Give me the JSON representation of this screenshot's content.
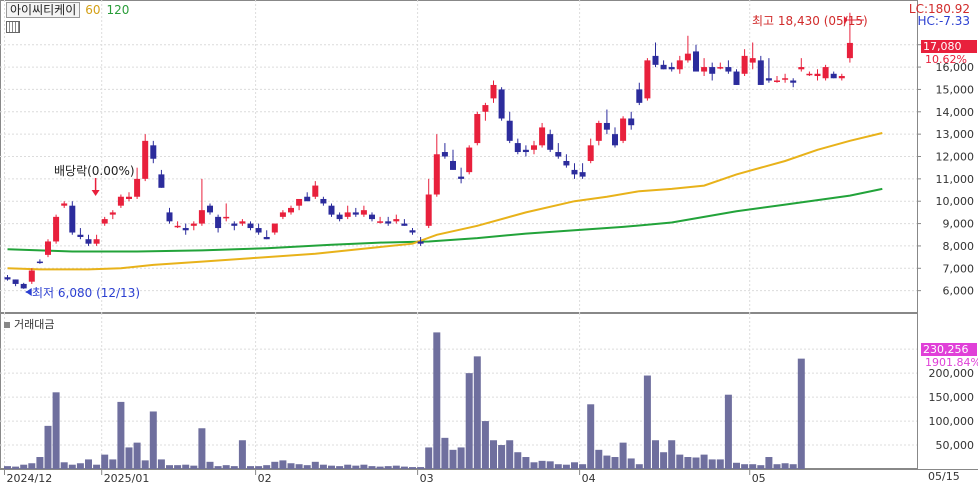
{
  "header": {
    "stock_name": "아이씨티케이",
    "ma_labels": [
      "60",
      "120"
    ],
    "lc": "LC:180.92",
    "hc": "HC:-7.33",
    "volume_title": "거래대금"
  },
  "current": {
    "price_label": "17,080",
    "pct_label": "10.62%",
    "volume_label": "230,256",
    "volume_pct_label": "1901.84%"
  },
  "annotations": {
    "high": "최고 18,430 (05/15)",
    "low": "최저 6,080 (12/13)",
    "dividend": "배당락(0.00%)"
  },
  "latest_date": "05/15",
  "colors": {
    "up": "#e8203c",
    "down": "#2c2c9c",
    "ma60": "#e8b21a",
    "ma120": "#22a33a",
    "volume": "#6f6f9e"
  },
  "chart_data": {
    "type": "candlestick",
    "price_axis": {
      "min": 5000,
      "max": 19000,
      "ticks": [
        "6,000",
        "7,000",
        "8,000",
        "9,000",
        "10,000",
        "11,000",
        "12,000",
        "13,000",
        "14,000",
        "15,000",
        "16,000",
        "17,000"
      ]
    },
    "volume_axis": {
      "min": 0,
      "max": 290000,
      "ticks": [
        "50,000",
        "100,000",
        "150,000",
        "200,000",
        "250,000"
      ]
    },
    "x_labels": [
      {
        "label": "2024/12",
        "index": 0
      },
      {
        "label": "2025/01",
        "index": 12
      },
      {
        "label": "02",
        "index": 31
      },
      {
        "label": "03",
        "index": 51
      },
      {
        "label": "04",
        "index": 71
      },
      {
        "label": "05",
        "index": 92
      }
    ],
    "candles": [
      [
        6600,
        6700,
        6450,
        6500
      ],
      [
        6500,
        6500,
        6200,
        6300
      ],
      [
        6300,
        6350,
        6080,
        6100
      ],
      [
        6400,
        7000,
        6300,
        6900
      ],
      [
        7300,
        7400,
        7200,
        7250
      ],
      [
        7600,
        8300,
        7500,
        8200
      ],
      [
        8200,
        9400,
        8100,
        9300
      ],
      [
        9800,
        10000,
        9700,
        9900
      ],
      [
        9800,
        10000,
        8500,
        8600
      ],
      [
        8500,
        8800,
        8300,
        8400
      ],
      [
        8300,
        8500,
        8000,
        8100
      ],
      [
        8100,
        8500,
        8000,
        8300
      ],
      [
        9000,
        9300,
        8900,
        9200
      ],
      [
        9400,
        9600,
        9200,
        9500
      ],
      [
        9800,
        10300,
        9700,
        10200
      ],
      [
        10100,
        10400,
        10000,
        10200
      ],
      [
        10200,
        11500,
        10100,
        11000
      ],
      [
        11000,
        13000,
        10900,
        12700
      ],
      [
        12500,
        12700,
        11700,
        11900
      ],
      [
        11200,
        11400,
        10600,
        10600
      ],
      [
        9500,
        9700,
        9000,
        9100
      ],
      [
        8900,
        9100,
        8800,
        8900
      ],
      [
        8800,
        9000,
        8500,
        8700
      ],
      [
        8900,
        9100,
        8700,
        9000
      ],
      [
        9000,
        11000,
        8900,
        9600
      ],
      [
        9800,
        9900,
        9400,
        9500
      ],
      [
        9300,
        9400,
        8600,
        8800
      ],
      [
        9300,
        9900,
        9100,
        9300
      ],
      [
        9000,
        9100,
        8700,
        8900
      ],
      [
        9000,
        9200,
        8900,
        9100
      ],
      [
        9000,
        9100,
        8700,
        8800
      ],
      [
        8800,
        9000,
        8500,
        8600
      ],
      [
        8400,
        8700,
        8300,
        8300
      ],
      [
        8600,
        9000,
        8500,
        9000
      ],
      [
        9300,
        9600,
        9200,
        9500
      ],
      [
        9500,
        9800,
        9400,
        9700
      ],
      [
        9800,
        10000,
        9600,
        10100
      ],
      [
        10200,
        10400,
        10000,
        10000
      ],
      [
        10200,
        10900,
        10100,
        10700
      ],
      [
        10100,
        10200,
        9800,
        9900
      ],
      [
        9800,
        9900,
        9300,
        9400
      ],
      [
        9400,
        9500,
        9100,
        9200
      ],
      [
        9300,
        9800,
        9200,
        9500
      ],
      [
        9500,
        9700,
        9300,
        9400
      ],
      [
        9400,
        9800,
        9300,
        9600
      ],
      [
        9400,
        9500,
        9100,
        9200
      ],
      [
        9100,
        9300,
        9000,
        9100
      ],
      [
        9100,
        9300,
        8900,
        9000
      ],
      [
        9100,
        9400,
        9000,
        9200
      ],
      [
        9000,
        9200,
        8900,
        8900
      ],
      [
        8700,
        8800,
        8500,
        8600
      ],
      [
        8200,
        8400,
        8000,
        8100
      ],
      [
        8900,
        11000,
        8800,
        10300
      ],
      [
        10300,
        13000,
        10200,
        12100
      ],
      [
        12200,
        12600,
        11900,
        12000
      ],
      [
        11800,
        12300,
        11400,
        11400
      ],
      [
        11100,
        11500,
        10800,
        11000
      ],
      [
        11300,
        12500,
        11200,
        12400
      ],
      [
        12600,
        14000,
        12500,
        13900
      ],
      [
        14000,
        14400,
        13600,
        14300
      ],
      [
        14600,
        15400,
        14400,
        15200
      ],
      [
        15000,
        15100,
        13600,
        13700
      ],
      [
        13600,
        14000,
        12600,
        12700
      ],
      [
        12600,
        12800,
        12100,
        12200
      ],
      [
        12300,
        12500,
        12000,
        12200
      ],
      [
        12300,
        12700,
        12100,
        12500
      ],
      [
        12500,
        13500,
        12400,
        13300
      ],
      [
        13000,
        13200,
        12200,
        12300
      ],
      [
        12200,
        12600,
        11900,
        12000
      ],
      [
        11800,
        12100,
        11500,
        11600
      ],
      [
        11400,
        11700,
        11000,
        11200
      ],
      [
        11300,
        11700,
        11000,
        11100
      ],
      [
        11800,
        12800,
        11700,
        12500
      ],
      [
        12700,
        13600,
        12500,
        13500
      ],
      [
        13500,
        14100,
        13000,
        13200
      ],
      [
        13000,
        13300,
        12400,
        12500
      ],
      [
        12700,
        13800,
        12600,
        13700
      ],
      [
        13700,
        14000,
        13200,
        13400
      ],
      [
        15000,
        15300,
        14300,
        14400
      ],
      [
        14600,
        16400,
        14500,
        16300
      ],
      [
        16500,
        17100,
        16000,
        16100
      ],
      [
        16100,
        16300,
        15900,
        15900
      ],
      [
        16000,
        16200,
        15800,
        15900
      ],
      [
        15900,
        16500,
        15700,
        16300
      ],
      [
        16300,
        17400,
        16200,
        16600
      ],
      [
        16700,
        17000,
        15800,
        15800
      ],
      [
        15800,
        16400,
        15600,
        16000
      ],
      [
        16000,
        16200,
        15400,
        15700
      ],
      [
        16000,
        16200,
        15900,
        16000
      ],
      [
        16000,
        16300,
        15700,
        15800
      ],
      [
        15800,
        15900,
        15200,
        15200
      ],
      [
        15700,
        16800,
        15600,
        16500
      ],
      [
        16200,
        17100,
        15900,
        16400
      ],
      [
        16300,
        16500,
        15200,
        15200
      ],
      [
        15500,
        16400,
        15300,
        15400
      ],
      [
        15400,
        15600,
        15300,
        15400
      ],
      [
        15500,
        15700,
        15300,
        15500
      ],
      [
        15400,
        15500,
        15100,
        15300
      ],
      [
        15900,
        16400,
        15800,
        16000
      ],
      [
        15700,
        15800,
        15600,
        15700
      ],
      [
        15600,
        15900,
        15400,
        15700
      ],
      [
        15500,
        16100,
        15400,
        16000
      ],
      [
        15700,
        15800,
        15500,
        15500
      ],
      [
        15500,
        15700,
        15400,
        15600
      ],
      [
        16400,
        18430,
        16200,
        17080
      ]
    ],
    "ma60": [
      [
        0,
        7000
      ],
      [
        4,
        6950
      ],
      [
        10,
        6950
      ],
      [
        14,
        7000
      ],
      [
        18,
        7150
      ],
      [
        24,
        7300
      ],
      [
        30,
        7450
      ],
      [
        38,
        7650
      ],
      [
        46,
        7950
      ],
      [
        50,
        8100
      ],
      [
        53,
        8500
      ],
      [
        58,
        8900
      ],
      [
        64,
        9500
      ],
      [
        70,
        10000
      ],
      [
        74,
        10200
      ],
      [
        78,
        10450
      ],
      [
        82,
        10550
      ],
      [
        86,
        10700
      ],
      [
        90,
        11200
      ],
      [
        96,
        11800
      ],
      [
        100,
        12300
      ],
      [
        104,
        12700
      ],
      [
        108,
        13050
      ]
    ],
    "ma120": [
      [
        0,
        7850
      ],
      [
        8,
        7750
      ],
      [
        16,
        7750
      ],
      [
        24,
        7800
      ],
      [
        32,
        7900
      ],
      [
        40,
        8050
      ],
      [
        46,
        8150
      ],
      [
        52,
        8200
      ],
      [
        58,
        8350
      ],
      [
        64,
        8550
      ],
      [
        70,
        8700
      ],
      [
        76,
        8850
      ],
      [
        82,
        9050
      ],
      [
        86,
        9300
      ],
      [
        90,
        9550
      ],
      [
        96,
        9850
      ],
      [
        100,
        10050
      ],
      [
        104,
        10250
      ],
      [
        108,
        10550
      ]
    ],
    "volume": [
      6000,
      5000,
      9000,
      12000,
      25000,
      90000,
      160000,
      14000,
      9000,
      12000,
      20000,
      9000,
      30000,
      20000,
      140000,
      45000,
      55000,
      18000,
      120000,
      20000,
      8000,
      8000,
      9000,
      7000,
      85000,
      15000,
      6000,
      8000,
      6000,
      60000,
      6000,
      6000,
      8000,
      15000,
      18000,
      12000,
      10000,
      8000,
      15000,
      9000,
      7000,
      6000,
      9000,
      7000,
      9000,
      6000,
      5000,
      6000,
      7000,
      5000,
      4000,
      4000,
      45000,
      285000,
      65000,
      40000,
      45000,
      200000,
      235000,
      100000,
      60000,
      50000,
      60000,
      35000,
      25000,
      14000,
      17000,
      16000,
      10000,
      9000,
      14000,
      10000,
      135000,
      40000,
      28000,
      25000,
      55000,
      22000,
      10000,
      195000,
      60000,
      35000,
      60000,
      30000,
      25000,
      24000,
      30000,
      20000,
      20000,
      155000,
      13000,
      10000,
      10000,
      8000,
      25000,
      10000,
      12000,
      10000,
      230256
    ]
  }
}
